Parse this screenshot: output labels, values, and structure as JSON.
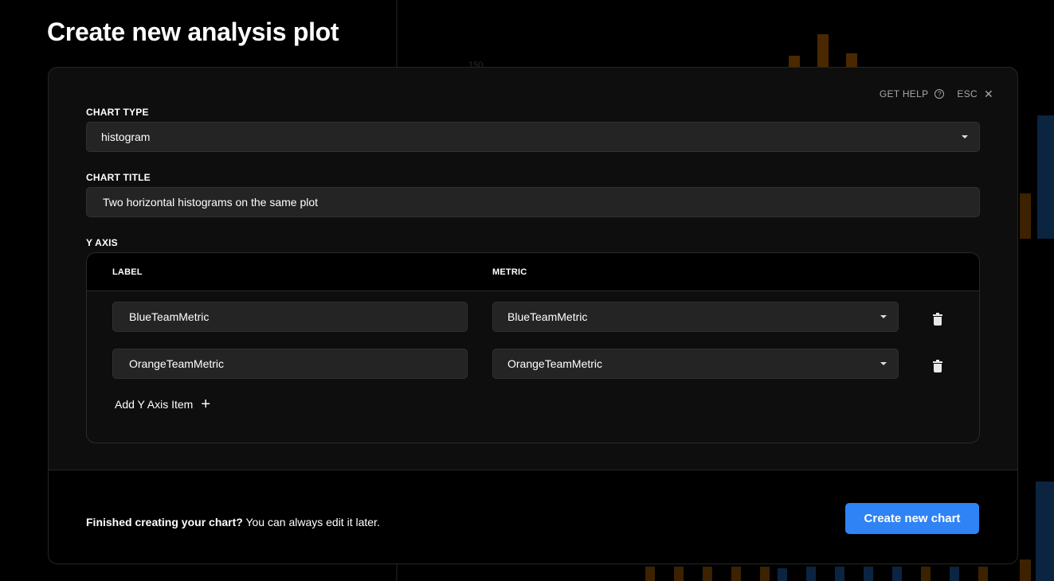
{
  "page": {
    "title": "Create new analysis plot"
  },
  "background": {
    "tick_label": "150"
  },
  "modal": {
    "help_label": "GET HELP",
    "help_icon": "question-circle-icon",
    "esc_label": "ESC",
    "close_icon": "close-icon",
    "chart_type": {
      "label": "CHART TYPE",
      "value": "histogram"
    },
    "chart_title": {
      "label": "CHART TITLE",
      "value": "Two horizontal histograms on the same plot"
    },
    "y_axis": {
      "label": "Y AXIS",
      "columns": {
        "label": "LABEL",
        "metric": "METRIC"
      },
      "rows": [
        {
          "label": "BlueTeamMetric",
          "metric": "BlueTeamMetric"
        },
        {
          "label": "OrangeTeamMetric",
          "metric": "OrangeTeamMetric"
        }
      ],
      "add_label": "Add Y Axis Item"
    },
    "footer": {
      "bold_text": "Finished creating your chart?",
      "text": " You can always edit it later.",
      "submit_label": "Create new chart"
    }
  },
  "colors": {
    "primary": "#2f83f5",
    "bg_orange": "#5a3000",
    "bg_blue": "#0b2a4a"
  }
}
